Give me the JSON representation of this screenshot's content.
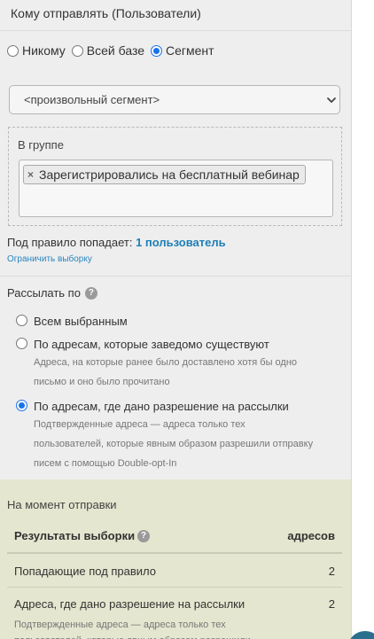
{
  "header": {
    "title": "Кому отправлять (Пользователи)"
  },
  "recipients": {
    "options": [
      {
        "label": "Никому",
        "selected": false
      },
      {
        "label": "Всей базе",
        "selected": false
      },
      {
        "label": "Сегмент",
        "selected": true
      }
    ]
  },
  "segment_select": {
    "value": "<произвольный сегмент>"
  },
  "group": {
    "label": "В группе",
    "tags": [
      {
        "label": "Зарегистрировались на бесплатный вебинар",
        "remove_icon": "×"
      }
    ]
  },
  "rule": {
    "prefix": "Под правило попадает: ",
    "count_text": "1 пользователь",
    "limit_link": "Ограничить выборку"
  },
  "send_to": {
    "label": "Рассылать по",
    "help_icon": "?",
    "options": [
      {
        "label": "Всем выбранным",
        "selected": false,
        "description": ""
      },
      {
        "label": "По адресам, которые заведомо существуют",
        "selected": false,
        "description": "Адреса, на которые ранее было доставлено хотя бы одно письмо и оно было прочитано"
      },
      {
        "label": "По адресам, где дано разрешение на рассылки",
        "selected": true,
        "description": "Подтвержденные адреса — адреса только тех пользователей, которые явным образом разрешили отправку писем с помощью Double-opt-In"
      }
    ]
  },
  "results": {
    "title": "На момент отправки",
    "header": {
      "col1": "Результаты выборки",
      "col2": "адресов",
      "help_icon": "?"
    },
    "rows": [
      {
        "label": "Попадающие под правило",
        "count": "2",
        "description": ""
      },
      {
        "label": "Адреса, где дано разрешение на рассылки",
        "count": "2",
        "description": "Подтвержденные адреса — адреса только тех пользователей, которые явным образом разрешили"
      }
    ]
  },
  "colors": {
    "accent": "#1a73e8",
    "link": "#2a86c0",
    "results_bg": "#e4e6cf"
  }
}
